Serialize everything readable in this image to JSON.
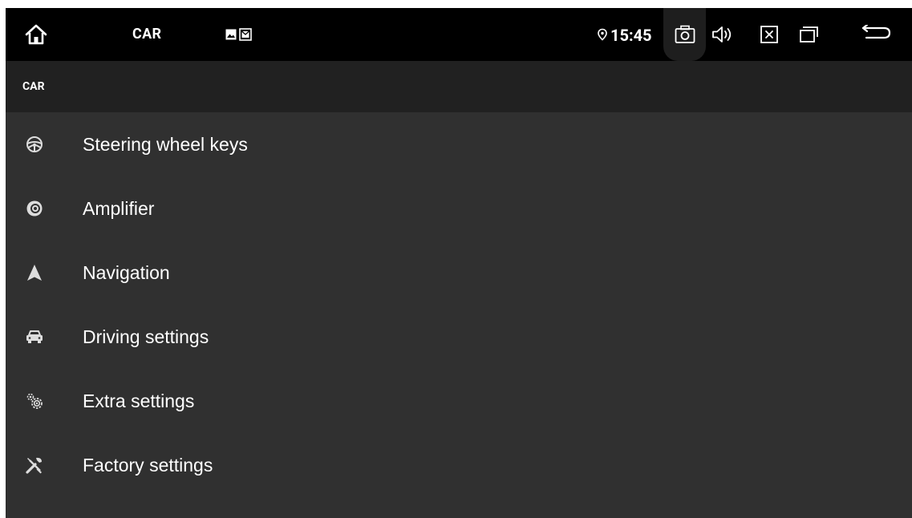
{
  "status_bar": {
    "app_title": "CAR",
    "time": "15:45",
    "icons": [
      "home-icon",
      "gallery-notification-icon",
      "mail-notification-icon",
      "location-icon",
      "screenshot-camera-icon",
      "volume-icon",
      "close-app-icon",
      "recent-apps-icon",
      "back-icon"
    ]
  },
  "header": {
    "title": "CAR"
  },
  "menu": {
    "items": [
      {
        "label": "Steering wheel keys",
        "icon": "steering-wheel-icon"
      },
      {
        "label": "Amplifier",
        "icon": "speaker-icon"
      },
      {
        "label": "Navigation",
        "icon": "navigation-arrow-icon"
      },
      {
        "label": "Driving settings",
        "icon": "car-icon"
      },
      {
        "label": "Extra settings",
        "icon": "gears-icon"
      },
      {
        "label": "Factory settings",
        "icon": "tools-icon"
      }
    ]
  },
  "colors": {
    "status_bar_bg": "#000000",
    "header_bg": "#212121",
    "content_bg": "#303030",
    "text": "#ffffff",
    "icon": "#dddddd"
  }
}
